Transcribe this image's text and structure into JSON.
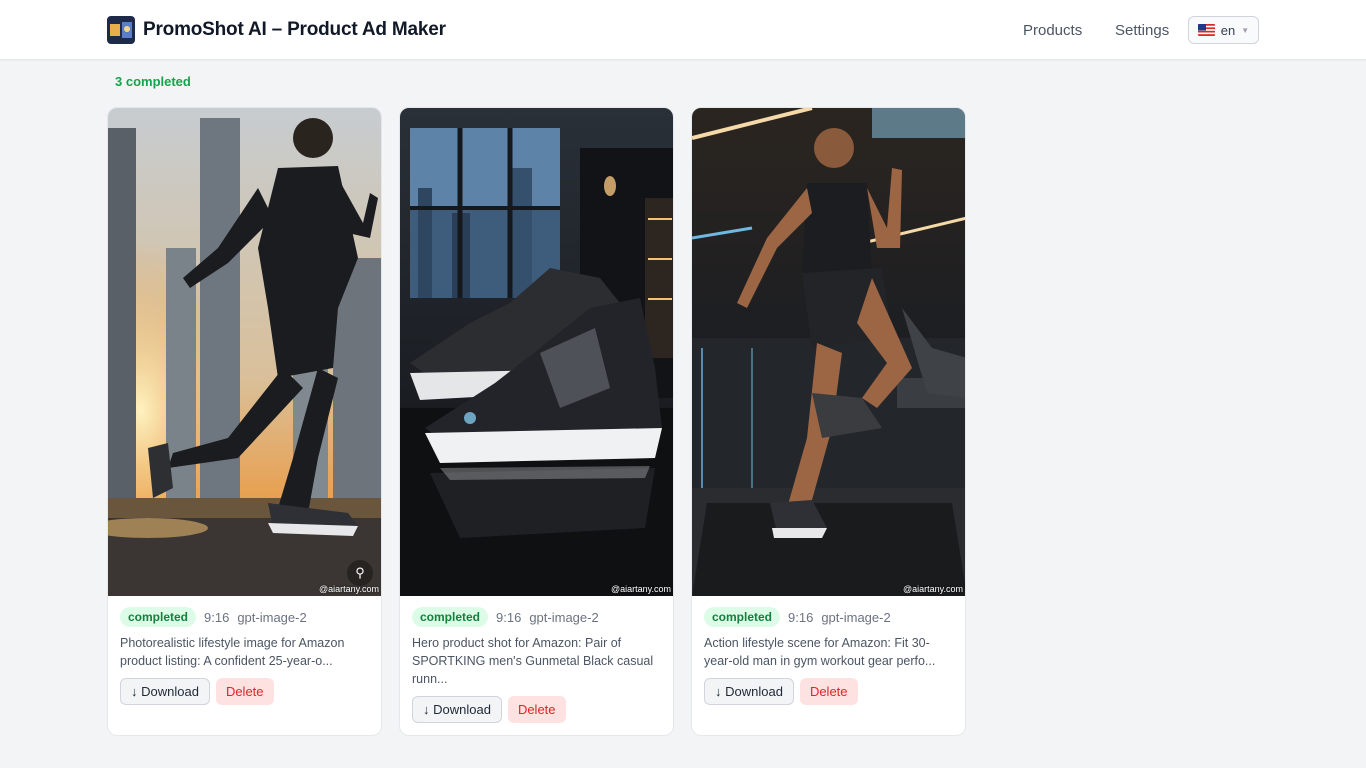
{
  "header": {
    "title": "PromoShot AI – Product Ad Maker",
    "nav": {
      "products": "Products",
      "settings": "Settings"
    },
    "language": {
      "code": "en",
      "flag_icon": "us-flag-icon"
    }
  },
  "gallery": {
    "status_summary": "3 completed",
    "cards": [
      {
        "status": "completed",
        "ratio": "9:16",
        "model": "gpt-image-2",
        "description": "Photorealistic lifestyle image for Amazon product listing: A confident 25-year-o...",
        "download_label": "↓ Download",
        "delete_label": "Delete",
        "watermark": "@aiartany.com",
        "scene": "runner-city-sunset"
      },
      {
        "status": "completed",
        "ratio": "9:16",
        "model": "gpt-image-2",
        "description": "Hero product shot for Amazon: Pair of SPORTKING men's Gunmetal Black casual runn...",
        "download_label": "↓ Download",
        "delete_label": "Delete",
        "watermark": "@aiartany.com",
        "scene": "sneakers-hero-shot"
      },
      {
        "status": "completed",
        "ratio": "9:16",
        "model": "gpt-image-2",
        "description": "Action lifestyle scene for Amazon: Fit 30-year-old man in gym workout gear perfo...",
        "download_label": "↓ Download",
        "delete_label": "Delete",
        "watermark": "@aiartany.com",
        "scene": "gym-treadmill-runner"
      }
    ]
  },
  "colors": {
    "accent_green": "#16a34a",
    "badge_bg": "#dcfce7",
    "delete_red": "#dc2626",
    "delete_bg": "#fee2e2"
  }
}
